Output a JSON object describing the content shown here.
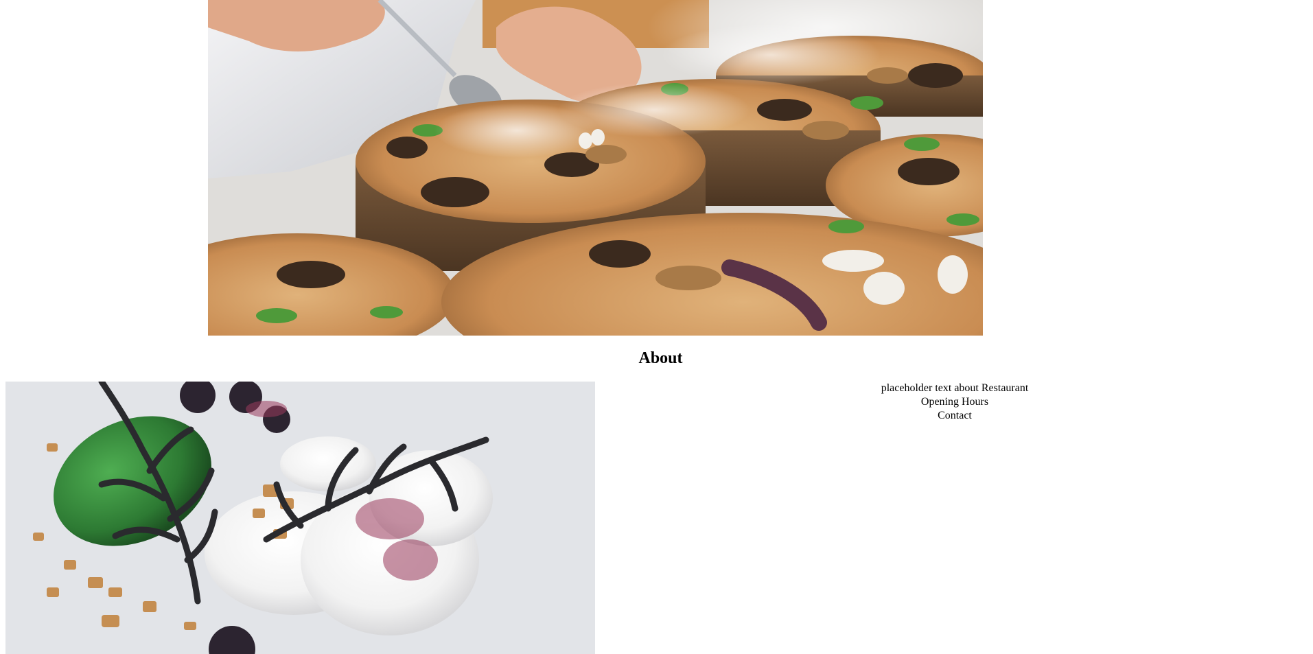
{
  "hero": {
    "icon": "hero-food-plating-image"
  },
  "about": {
    "heading": "About",
    "placeholder_text": "placeholder text about Restaurant",
    "opening_hours": "Opening Hours",
    "contact": "Contact"
  },
  "dessert": {
    "icon": "dessert-plate-image"
  }
}
